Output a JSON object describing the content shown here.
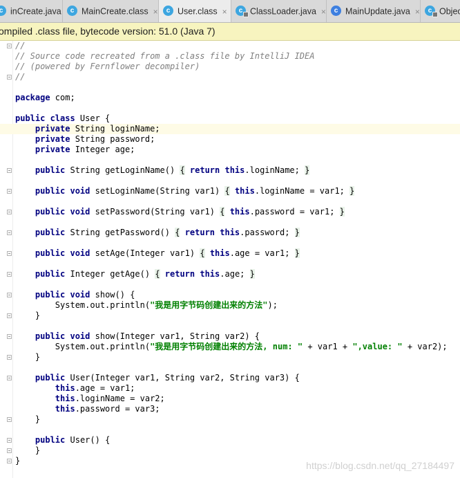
{
  "tabs": [
    {
      "label": "inCreate.java",
      "icon": "class-icon",
      "color": "#3da6e0",
      "lock": false,
      "active": false
    },
    {
      "label": "MainCreate.class",
      "icon": "class-icon",
      "color": "#3da6e0",
      "lock": false,
      "active": false
    },
    {
      "label": "User.class",
      "icon": "class-icon",
      "color": "#3da6e0",
      "lock": false,
      "active": true
    },
    {
      "label": "ClassLoader.java",
      "icon": "class-locked-icon",
      "color": "#3da6e0",
      "lock": true,
      "active": false
    },
    {
      "label": "MainUpdate.java",
      "icon": "class-icon",
      "color": "#3d7fe0",
      "lock": false,
      "active": false
    },
    {
      "label": "Object",
      "icon": "class-locked-icon",
      "color": "#3da6e0",
      "lock": true,
      "active": false
    }
  ],
  "tab_close_glyph": "×",
  "banner": {
    "text": "ompiled .class file, bytecode version: 51.0 (Java 7)",
    "background": "#f7f4bf"
  },
  "code": {
    "language": "java",
    "current_line": 8,
    "lines": [
      [
        [
          "cmt",
          "//"
        ]
      ],
      [
        [
          "cmt",
          "// Source code recreated from a .class file by IntelliJ IDEA"
        ]
      ],
      [
        [
          "cmt",
          "// (powered by Fernflower decompiler)"
        ]
      ],
      [
        [
          "cmt",
          "//"
        ]
      ],
      [],
      [
        [
          "kw",
          "package"
        ],
        [
          "",
          " com;"
        ]
      ],
      [],
      [
        [
          "kw",
          "public class"
        ],
        [
          "",
          " User {"
        ]
      ],
      [
        [
          "",
          "    "
        ],
        [
          "kw",
          "private"
        ],
        [
          "",
          " String loginName;"
        ]
      ],
      [
        [
          "",
          "    "
        ],
        [
          "kw",
          "private"
        ],
        [
          "",
          " String password;"
        ]
      ],
      [
        [
          "",
          "    "
        ],
        [
          "kw",
          "private"
        ],
        [
          "",
          " Integer age;"
        ]
      ],
      [],
      [
        [
          "",
          "    "
        ],
        [
          "kw",
          "public"
        ],
        [
          "",
          " String getLoginName() "
        ],
        [
          "brace",
          "{"
        ],
        [
          "",
          " "
        ],
        [
          "kw",
          "return this"
        ],
        [
          "",
          ".loginName; "
        ],
        [
          "brace",
          "}"
        ]
      ],
      [],
      [
        [
          "",
          "    "
        ],
        [
          "kw",
          "public void"
        ],
        [
          "",
          " setLoginName(String var1) "
        ],
        [
          "brace",
          "{"
        ],
        [
          "",
          " "
        ],
        [
          "kw",
          "this"
        ],
        [
          "",
          ".loginName = var1; "
        ],
        [
          "brace",
          "}"
        ]
      ],
      [],
      [
        [
          "",
          "    "
        ],
        [
          "kw",
          "public void"
        ],
        [
          "",
          " setPassword(String var1) "
        ],
        [
          "brace",
          "{"
        ],
        [
          "",
          " "
        ],
        [
          "kw",
          "this"
        ],
        [
          "",
          ".password = var1; "
        ],
        [
          "brace",
          "}"
        ]
      ],
      [],
      [
        [
          "",
          "    "
        ],
        [
          "kw",
          "public"
        ],
        [
          "",
          " String getPassword() "
        ],
        [
          "brace",
          "{"
        ],
        [
          "",
          " "
        ],
        [
          "kw",
          "return this"
        ],
        [
          "",
          ".password; "
        ],
        [
          "brace",
          "}"
        ]
      ],
      [],
      [
        [
          "",
          "    "
        ],
        [
          "kw",
          "public void"
        ],
        [
          "",
          " setAge(Integer var1) "
        ],
        [
          "brace",
          "{"
        ],
        [
          "",
          " "
        ],
        [
          "kw",
          "this"
        ],
        [
          "",
          ".age = var1; "
        ],
        [
          "brace",
          "}"
        ]
      ],
      [],
      [
        [
          "",
          "    "
        ],
        [
          "kw",
          "public"
        ],
        [
          "",
          " Integer getAge() "
        ],
        [
          "brace",
          "{"
        ],
        [
          "",
          " "
        ],
        [
          "kw",
          "return this"
        ],
        [
          "",
          ".age; "
        ],
        [
          "brace",
          "}"
        ]
      ],
      [],
      [
        [
          "",
          "    "
        ],
        [
          "kw",
          "public void"
        ],
        [
          "",
          " show() {"
        ]
      ],
      [
        [
          "",
          "        System.out.println("
        ],
        [
          "str",
          "\"我是用字节码创建出来的方法\""
        ],
        [
          "",
          ");"
        ]
      ],
      [
        [
          "",
          "    }"
        ]
      ],
      [],
      [
        [
          "",
          "    "
        ],
        [
          "kw",
          "public void"
        ],
        [
          "",
          " show(Integer var1, String var2) {"
        ]
      ],
      [
        [
          "",
          "        System.out.println("
        ],
        [
          "str",
          "\"我是用字节码创建出来的方法, num: \""
        ],
        [
          "",
          " + var1 + "
        ],
        [
          "str",
          "\",value: \""
        ],
        [
          "",
          " + var2);"
        ]
      ],
      [
        [
          "",
          "    }"
        ]
      ],
      [],
      [
        [
          "",
          "    "
        ],
        [
          "kw",
          "public"
        ],
        [
          "",
          " User(Integer var1, String var2, String var3) {"
        ]
      ],
      [
        [
          "",
          "        "
        ],
        [
          "kw",
          "this"
        ],
        [
          "",
          ".age = var1;"
        ]
      ],
      [
        [
          "",
          "        "
        ],
        [
          "kw",
          "this"
        ],
        [
          "",
          ".loginName = var2;"
        ]
      ],
      [
        [
          "",
          "        "
        ],
        [
          "kw",
          "this"
        ],
        [
          "",
          ".password = var3;"
        ]
      ],
      [
        [
          "",
          "    }"
        ]
      ],
      [],
      [
        [
          "",
          "    "
        ],
        [
          "kw",
          "public"
        ],
        [
          "",
          " User() {"
        ]
      ],
      [
        [
          "",
          "    }"
        ]
      ],
      [
        [
          "",
          "}"
        ]
      ]
    ]
  },
  "fold_lines": [
    0,
    3,
    12,
    14,
    16,
    18,
    20,
    22,
    24,
    26,
    28,
    30,
    32,
    36,
    38,
    39,
    40
  ],
  "watermark": "https://blog.csdn.net/qq_27184497",
  "colors": {
    "keyword": "#000080",
    "comment": "#808080",
    "string": "#008000",
    "current_line": "#fefbe6"
  }
}
